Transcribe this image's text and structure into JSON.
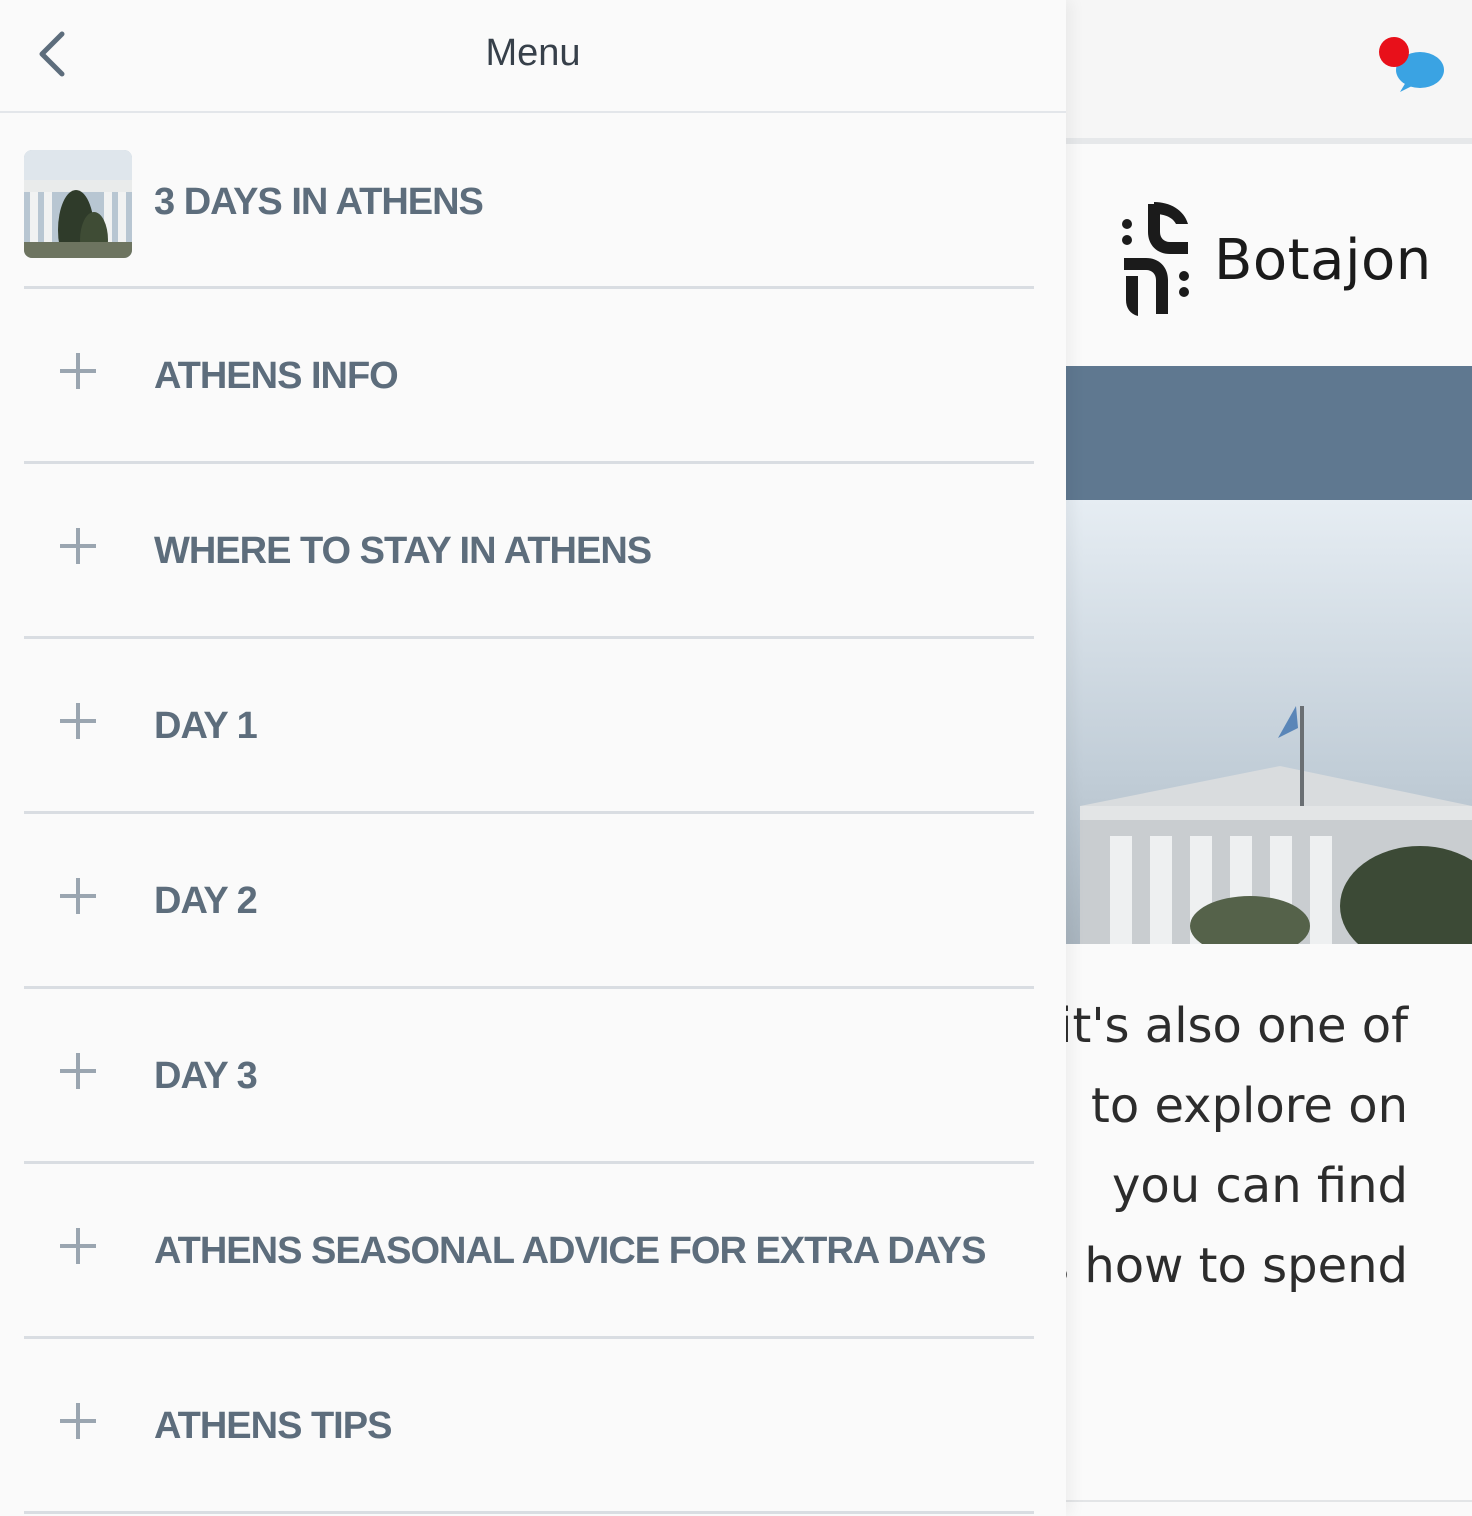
{
  "menu": {
    "title": "Menu",
    "items": [
      {
        "label": "3 DAYS IN ATHENS",
        "icon": "thumbnail-image"
      },
      {
        "label": "ATHENS INFO",
        "icon": "plus-icon"
      },
      {
        "label": "WHERE TO STAY IN ATHENS",
        "icon": "plus-icon"
      },
      {
        "label": "DAY 1",
        "icon": "plus-icon"
      },
      {
        "label": "DAY 2",
        "icon": "plus-icon"
      },
      {
        "label": "DAY 3",
        "icon": "plus-icon"
      },
      {
        "label": "ATHENS SEASONAL ADVICE FOR EXTRA DAYS",
        "icon": "plus-icon"
      },
      {
        "label": "ATHENS TIPS",
        "icon": "plus-icon"
      }
    ]
  },
  "page": {
    "brand": "Botajon",
    "article_lines": [
      "it's also one of",
      "to explore on",
      "you can find",
      "s how to spend"
    ]
  },
  "colors": {
    "menu_text": "#5d6d7c",
    "chat_badge": "#e8101a",
    "chat_bubble": "#3aa3e3"
  }
}
